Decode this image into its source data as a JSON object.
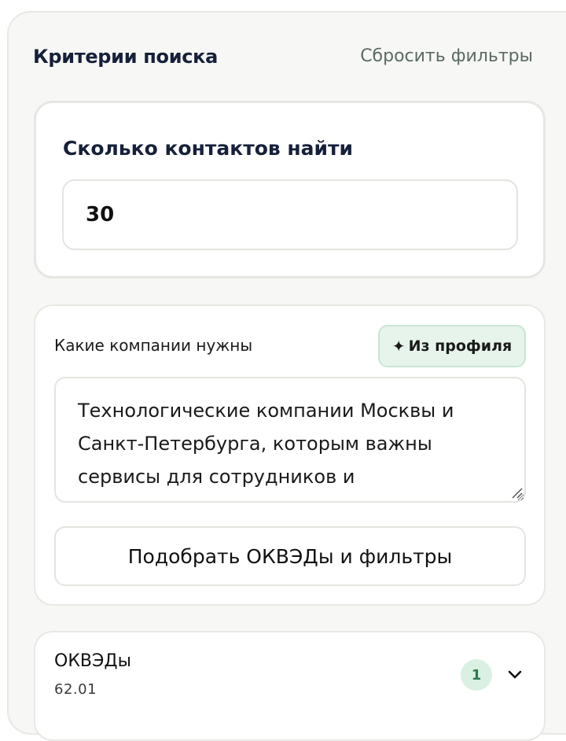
{
  "header": {
    "title": "Критерии поиска",
    "reset_label": "Сбросить фильтры"
  },
  "count_card": {
    "title": "Сколько контактов найти",
    "value": "30"
  },
  "companies_card": {
    "label": "Какие компании нужны",
    "profile_button": "Из профиля",
    "profile_icon": "sparkle-icon",
    "description": "Технологические компании Москвы и Санкт-Петербурга, которым важны сервисы для сотрудников и корпоративный",
    "match_button": "Подобрать ОКВЭДы и фильтры"
  },
  "okved_card": {
    "title": "ОКВЭДы",
    "value": "62.01",
    "count": "1",
    "icon": "chevron-down-icon"
  },
  "colors": {
    "accent": "#2f7a4c",
    "accent_bg": "#e6f4ec",
    "panel_bg": "#f7f7f5",
    "text_primary": "#16203a"
  }
}
